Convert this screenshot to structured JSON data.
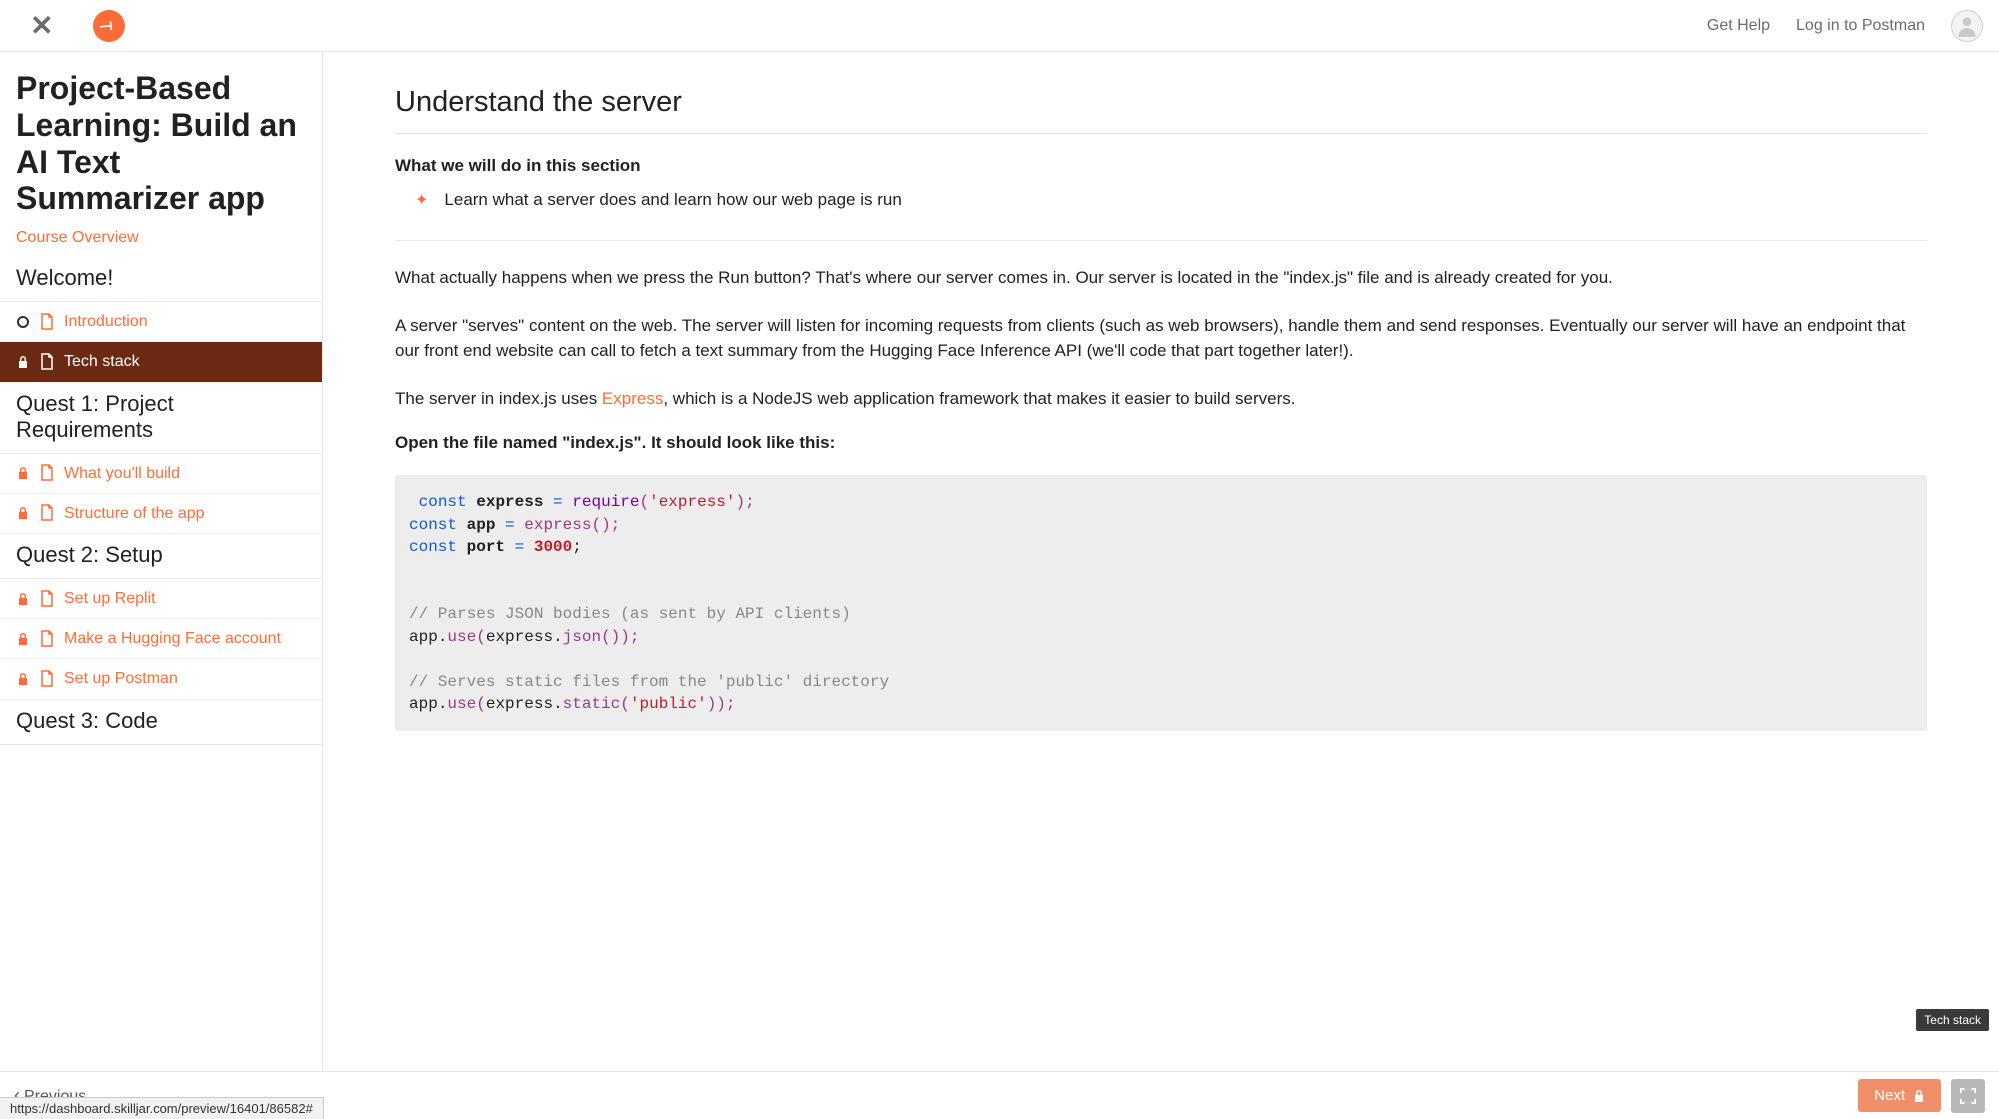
{
  "topbar": {
    "get_help": "Get Help",
    "login": "Log in to Postman"
  },
  "sidebar": {
    "title": "Project-Based Learning: Build an AI Text Summarizer app",
    "overview_link": "Course Overview",
    "sections": [
      {
        "header": "Welcome!"
      },
      {
        "header": "Quest 1: Project Requirements"
      },
      {
        "header": "Quest 2: Setup"
      },
      {
        "header": "Quest 3: Code"
      }
    ],
    "items": {
      "intro": "Introduction",
      "techstack": "Tech stack",
      "build": "What you'll build",
      "structure": "Structure of the app",
      "replit": "Set up Replit",
      "hf": "Make a Hugging Face account",
      "postman": "Set up Postman"
    }
  },
  "content": {
    "title": "Understand the server",
    "sub1": "What we will do in this section",
    "bullet1": "Learn what a server does and learn how our web page is run",
    "p1": "What actually happens when we press the Run button? That's where our server comes in. Our server is located in the \"index.js\" file and is already created for you.",
    "p2": "A server \"serves\" content on the web. The server will listen for incoming requests from clients (such as web browsers), handle them and send responses. Eventually our server will have an endpoint that our front end website can call to fetch a text summary from the Hugging Face Inference API (we'll code that part together later!).",
    "p3a": "The server in index.js uses ",
    "p3link": "Express",
    "p3b": ", which is a NodeJS web application framework that makes it easier to build servers.",
    "openfile": "Open the file named \"index.js\". It should look like this:",
    "code": {
      "l1_kw": "const",
      "l1_var": "express",
      "l1_eq": " = ",
      "l1_fn": "require",
      "l1_p1": "(",
      "l1_str": "'express'",
      "l1_p2": ");",
      "l2_kw": "const",
      "l2_var": "app",
      "l2_eq": " = ",
      "l2_call": "express",
      "l2_p": "();",
      "l3_kw": "const",
      "l3_var": "port",
      "l3_eq": " = ",
      "l3_num": "3000",
      "l3_sc": ";",
      "l4_cm": "// Parses JSON bodies (as sent by API clients)",
      "l5_a": "app",
      "l5_b": ".",
      "l5_c": "use",
      "l5_d": "(",
      "l5_e": "express",
      "l5_f": ".",
      "l5_g": "json",
      "l5_h": "());",
      "l6_cm": "// Serves static files from the 'public' directory",
      "l7_a": "app",
      "l7_b": ".",
      "l7_c": "use",
      "l7_d": "(",
      "l7_e": "express",
      "l7_f": ".",
      "l7_g": "static",
      "l7_h": "(",
      "l7_str": "'public'",
      "l7_i": "));"
    }
  },
  "footer": {
    "prev": "Previous",
    "next": "Next",
    "url": "https://dashboard.skilljar.com/preview/16401/86582#",
    "tooltip": "Tech stack"
  }
}
